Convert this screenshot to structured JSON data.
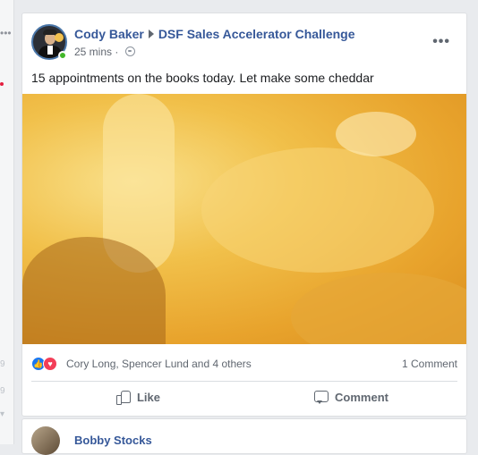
{
  "left_rail": {
    "more_glyph": "•••",
    "glyph_a": "9",
    "glyph_b": "9",
    "glyph_c": "▾"
  },
  "post": {
    "author": "Cody Baker",
    "group": "DSF Sales Accelerator Challenge",
    "timestamp": "25 mins",
    "privacy_separator": "·",
    "text": "15 appointments on the books today. Let make some cheddar",
    "more_options": "•••",
    "reactions": {
      "names": "Cory Long, Spencer Lund and 4 others",
      "comment_count": "1 Comment"
    },
    "actions": {
      "like_label": "Like",
      "comment_label": "Comment"
    }
  },
  "next_post": {
    "author": "Bobby Stocks"
  },
  "colors": {
    "link": "#365899",
    "like_blue": "#1877f2",
    "love_red": "#f33e58",
    "online_green": "#42b72a",
    "gif_gold": "#f1c04a"
  },
  "icons": [
    "more-icon",
    "globe-icon",
    "like-reaction-icon",
    "love-reaction-icon",
    "thumbs-up-icon",
    "comment-bubble-icon",
    "online-status-icon"
  ]
}
